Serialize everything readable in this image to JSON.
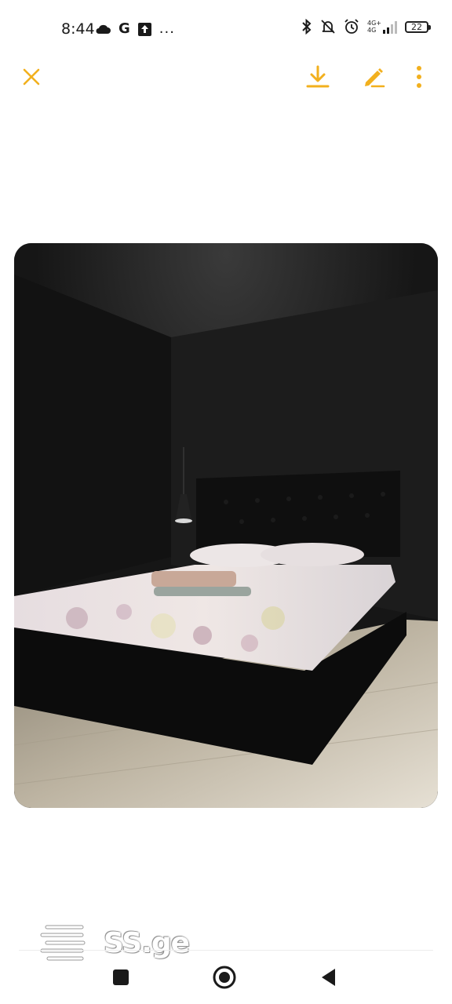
{
  "status_bar": {
    "time": "8:44",
    "left_icons": [
      "cloud-icon",
      "G",
      "upload-icon",
      "..."
    ],
    "network_label_top": "4G+",
    "network_label_bottom": "4G",
    "battery_level": "22",
    "right_icons": [
      "bluetooth-icon",
      "mute-icon",
      "alarm-icon",
      "signal-icon",
      "battery-icon"
    ]
  },
  "toolbar": {
    "close_icon": "close-icon",
    "download_icon": "download-icon",
    "edit_icon": "pencil-icon",
    "more_icon": "more-vertical-icon",
    "accent_color": "#F2B01E"
  },
  "photo": {
    "subject": "bedroom-photo"
  },
  "watermark": {
    "text": "SS.ge"
  },
  "nav_bar": {
    "icons": [
      "recent-apps-icon",
      "home-icon",
      "back-icon"
    ]
  }
}
